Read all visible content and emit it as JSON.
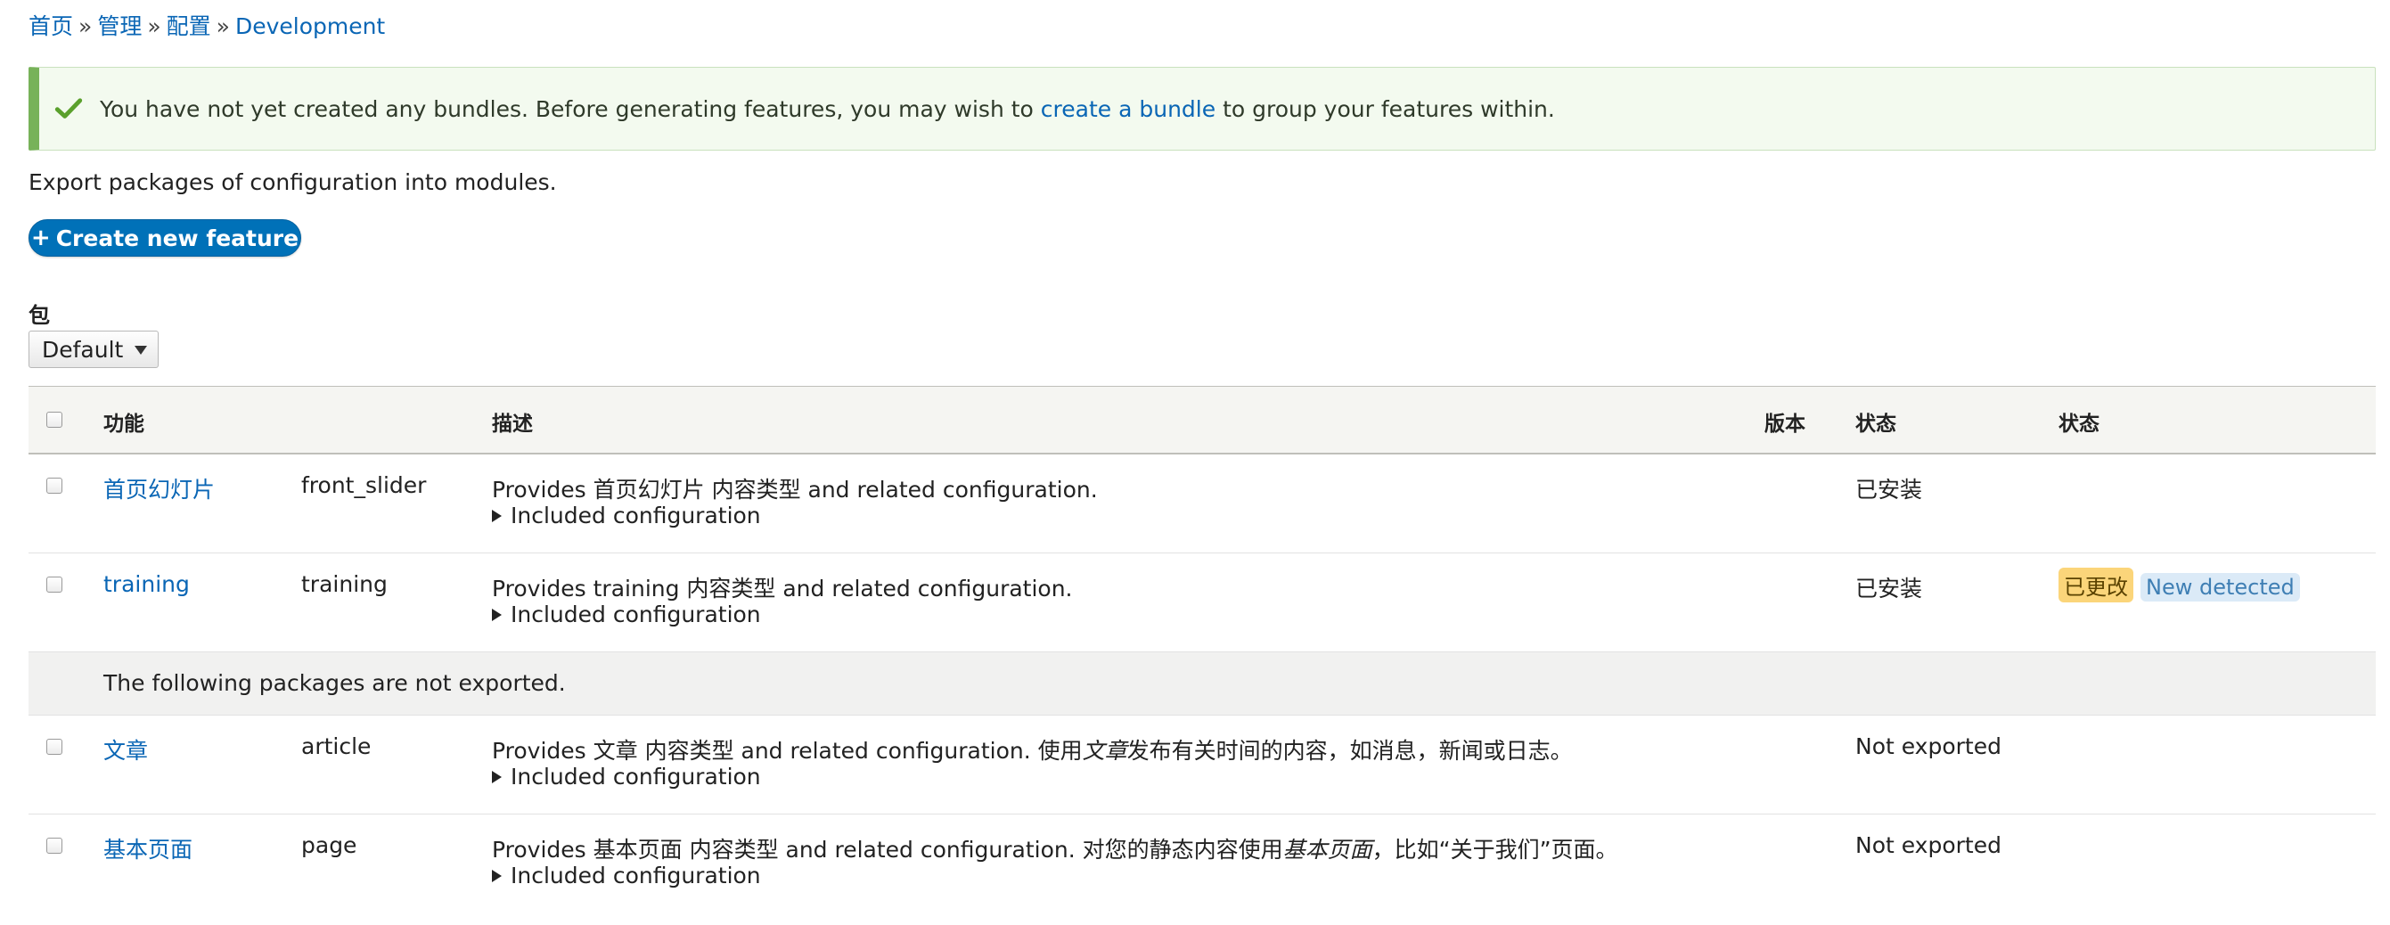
{
  "breadcrumb": {
    "items": [
      "首页",
      "管理",
      "配置",
      "Development"
    ],
    "separator": "»"
  },
  "message": {
    "text_before": "You have not yet created any bundles. Before generating features, you may wish to",
    "link_text": "create a bundle",
    "text_after": "to group your features within.",
    "icon": "check-icon",
    "accent_color": "#77b259"
  },
  "intro": "Export packages of configuration into modules.",
  "create_button": {
    "plus": "+",
    "label": "Create new feature",
    "color": "#0071b8"
  },
  "package": {
    "label": "包",
    "selected": "Default"
  },
  "table": {
    "headers": {
      "feature": "功能",
      "description": "描述",
      "version": "版本",
      "status": "状态",
      "state": "状态"
    },
    "group_label": "The following packages are not exported.",
    "included_label": "Included configuration",
    "rows": [
      {
        "title": "首页幻灯片",
        "machine": "front_slider",
        "desc_pre": "Provides 首页幻灯片 内容类型 and related configuration.",
        "desc_em1": "",
        "desc_mid": "",
        "desc_em2": "",
        "desc_post": "",
        "status": "已安装",
        "badge_changed": "",
        "badge_new": ""
      },
      {
        "title": "training",
        "machine": "training",
        "desc_pre": "Provides training 内容类型 and related configuration.",
        "desc_em1": "",
        "desc_mid": "",
        "desc_em2": "",
        "desc_post": "",
        "status": "已安装",
        "badge_changed": "已更改",
        "badge_new": "New detected"
      },
      {
        "title": "文章",
        "machine": "article",
        "desc_pre": "Provides 文章 内容类型 and related configuration. 使用",
        "desc_em1": "文章",
        "desc_mid": "发布有关时间的内容，如消息，新闻或日志。",
        "desc_em2": "",
        "desc_post": "",
        "status": "Not exported",
        "badge_changed": "",
        "badge_new": ""
      },
      {
        "title": "基本页面",
        "machine": "page",
        "desc_pre": "Provides 基本页面 内容类型 and related configuration. 对您的静态内容使用",
        "desc_em1": "基本页面",
        "desc_mid": "，比如“关于我们”页面。",
        "desc_em2": "",
        "desc_post": "",
        "status": "Not exported",
        "badge_changed": "",
        "badge_new": ""
      }
    ]
  }
}
